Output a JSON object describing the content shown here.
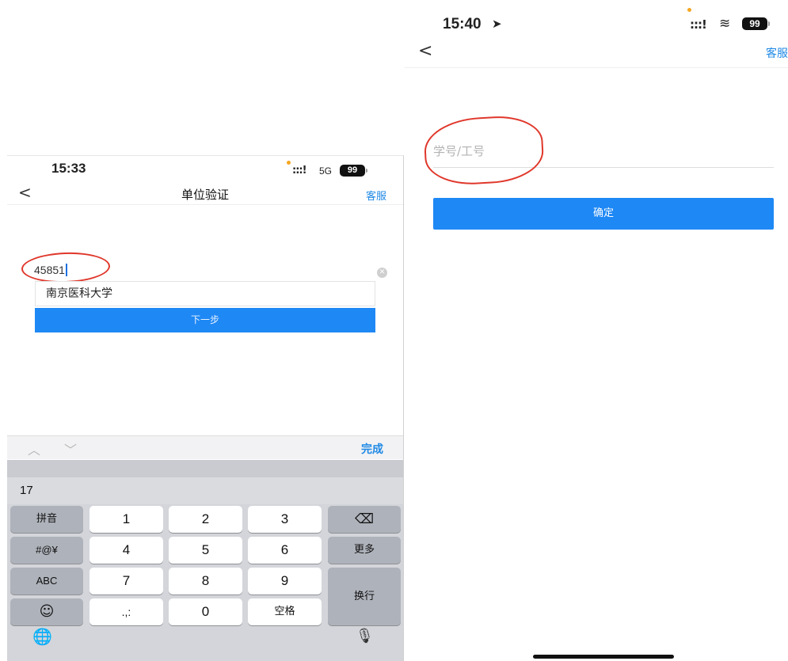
{
  "left_phone": {
    "status_bar": {
      "time": "15:33",
      "signal": ":::!",
      "network": "5G",
      "battery": "99"
    },
    "nav": {
      "back": "<",
      "title": "单位验证",
      "service": "客服"
    },
    "input": {
      "value": "45851",
      "clear_icon": "clear-icon"
    },
    "suggestion": "南京医科大学",
    "next_button": "下一步",
    "toolbar": {
      "up": "︿",
      "down": "﹀",
      "done": "完成"
    },
    "keyboard": {
      "candidate": "17",
      "keys": {
        "pinyin": "拼音",
        "k1": "1",
        "k2": "2",
        "k3": "3",
        "backspace": "⌫",
        "symbols": "#@¥",
        "k4": "4",
        "k5": "5",
        "k6": "6",
        "more": "更多",
        "abc": "ABC",
        "k7": "7",
        "k8": "8",
        "k9": "9",
        "enter": "换行",
        "emoji": "☺",
        "punct": ".,:",
        "k0": "0",
        "space": "空格"
      },
      "globe": "🌐",
      "mic": "🎙"
    },
    "annotation_color": "#e0372b",
    "accent": "#1e88f5"
  },
  "right_phone": {
    "status_bar": {
      "time": "15:40",
      "location": "➤",
      "signal": ":::!",
      "wifi": "≋",
      "battery": "99"
    },
    "nav": {
      "back": "<",
      "service": "客服"
    },
    "field_placeholder": "学号/工号",
    "confirm_button": "确定",
    "annotation_color": "#e0372b",
    "accent": "#1e88f5"
  }
}
